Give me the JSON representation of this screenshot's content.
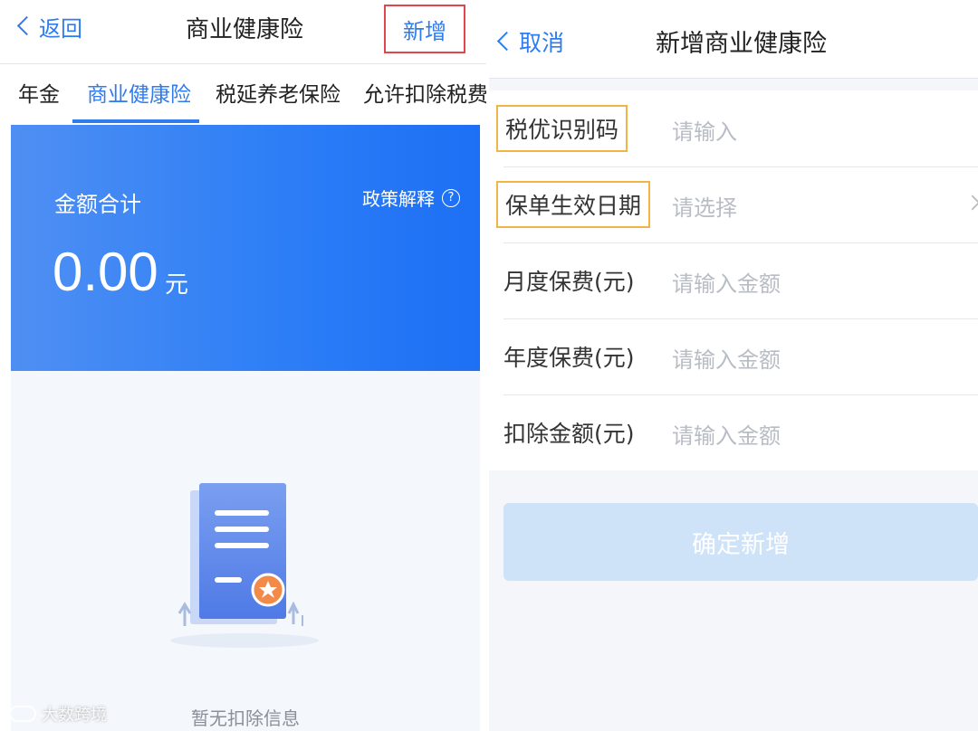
{
  "left": {
    "nav": {
      "back": "返回",
      "title": "商业健康险",
      "add": "新增"
    },
    "tabs": [
      {
        "label": "年金"
      },
      {
        "label": "商业健康险"
      },
      {
        "label": "税延养老保险"
      },
      {
        "label": "允许扣除税费"
      }
    ],
    "summary": {
      "label": "金额合计",
      "policy": "政策解释",
      "policy_icon": "?",
      "amount": "0.00",
      "currency": "元"
    },
    "empty_text": "暂无扣除信息"
  },
  "right": {
    "nav": {
      "back": "取消",
      "title": "新增商业健康险"
    },
    "fields": [
      {
        "label": "税优识别码",
        "value": "请输入"
      },
      {
        "label": "保单生效日期",
        "value": "请选择"
      },
      {
        "label": "月度保费(元)",
        "value": "请输入金额"
      },
      {
        "label": "年度保费(元)",
        "value": "请输入金额"
      },
      {
        "label": "扣除金额(元)",
        "value": "请输入金额"
      }
    ],
    "confirm": "确定新增"
  },
  "watermark": "大数跨境",
  "colors": {
    "accent": "#2f7bf0",
    "highlight_red": "#e0474c",
    "highlight_orange": "#f0b545",
    "banner": "#2e7ff6"
  }
}
